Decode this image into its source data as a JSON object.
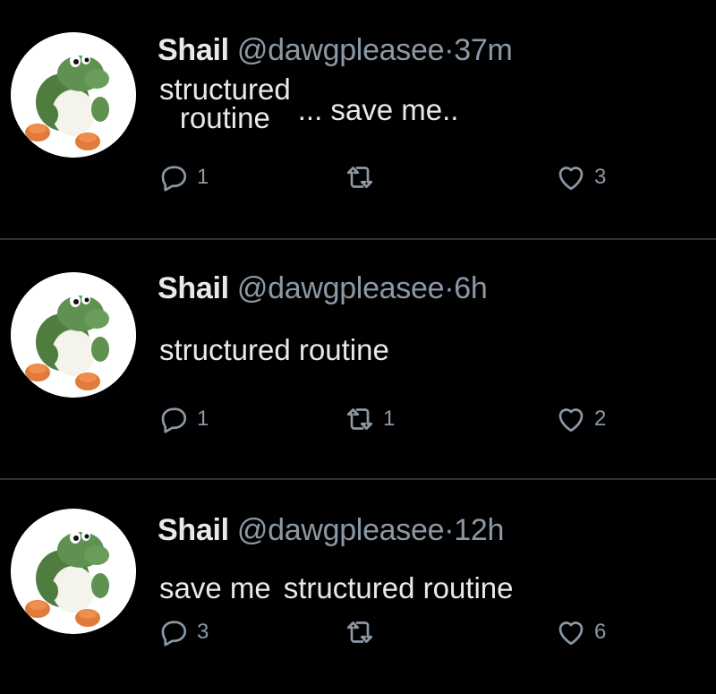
{
  "colors": {
    "background": "#000000",
    "primary_text": "#e7e9ea",
    "secondary_text": "#8b98a5",
    "divider": "#2f3336",
    "avatar_green": "#5a8a4a",
    "avatar_orange": "#e07b39"
  },
  "tweets": [
    {
      "author": {
        "name": "Shail",
        "handle": "@dawgpleasee",
        "avatar_icon": "yoshi-avatar-icon"
      },
      "separator": "·",
      "time": "37m",
      "body": {
        "stacked_line_1": "structured",
        "stacked_line_2": "routine",
        "ellipsis": "...",
        "after": "save me.."
      },
      "actions": {
        "reply_icon": "reply-icon",
        "retweet_icon": "retweet-icon",
        "like_icon": "heart-icon",
        "replies": "1",
        "retweets": "",
        "likes": "3"
      }
    },
    {
      "author": {
        "name": "Shail",
        "handle": "@dawgpleasee",
        "avatar_icon": "yoshi-avatar-icon"
      },
      "separator": "·",
      "time": "6h",
      "body": {
        "text": "structured routine"
      },
      "actions": {
        "reply_icon": "reply-icon",
        "retweet_icon": "retweet-icon",
        "like_icon": "heart-icon",
        "replies": "1",
        "retweets": "1",
        "likes": "2"
      }
    },
    {
      "author": {
        "name": "Shail",
        "handle": "@dawgpleasee",
        "avatar_icon": "yoshi-avatar-icon"
      },
      "separator": "·",
      "time": "12h",
      "body": {
        "part_1": "save me",
        "part_2": "structured routine"
      },
      "actions": {
        "reply_icon": "reply-icon",
        "retweet_icon": "retweet-icon",
        "like_icon": "heart-icon",
        "replies": "3",
        "retweets": "",
        "likes": "6"
      }
    }
  ]
}
